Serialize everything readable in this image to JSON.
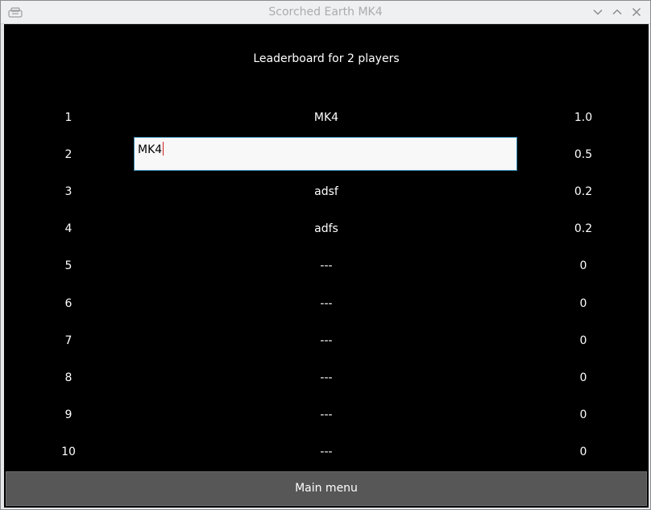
{
  "window": {
    "title": "Scorched Earth MK4",
    "icon": "game-controller-icon"
  },
  "leaderboard": {
    "heading": "Leaderboard for 2 players",
    "rows": [
      {
        "rank": "1",
        "name": "MK4",
        "score": "1.0"
      },
      {
        "rank": "2",
        "name": "MK4",
        "score": "0.5",
        "editing": true
      },
      {
        "rank": "3",
        "name": "adsf",
        "score": "0.2"
      },
      {
        "rank": "4",
        "name": "adfs",
        "score": "0.2"
      },
      {
        "rank": "5",
        "name": "---",
        "score": "0"
      },
      {
        "rank": "6",
        "name": "---",
        "score": "0"
      },
      {
        "rank": "7",
        "name": "---",
        "score": "0"
      },
      {
        "rank": "8",
        "name": "---",
        "score": "0"
      },
      {
        "rank": "9",
        "name": "---",
        "score": "0"
      },
      {
        "rank": "10",
        "name": "---",
        "score": "0"
      }
    ]
  },
  "name_input": {
    "value": "MK4"
  },
  "footer": {
    "main_menu_label": "Main menu"
  },
  "colors": {
    "background": "#000000",
    "text": "#ffffff",
    "button": "#575757",
    "input_border": "#3a8fb8"
  }
}
